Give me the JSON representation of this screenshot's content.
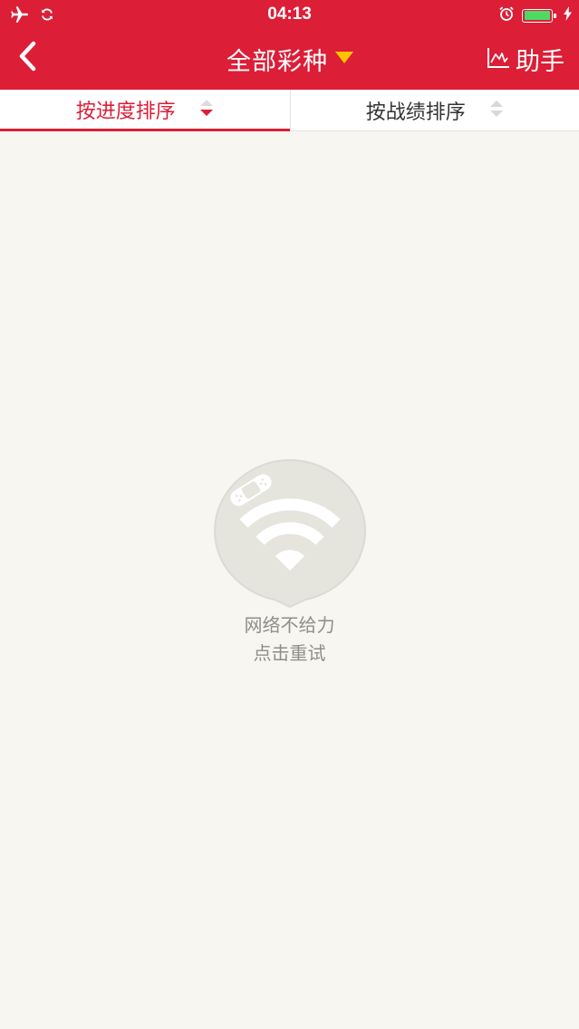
{
  "status_bar": {
    "time": "04:13",
    "battery_level": 1.0,
    "icons": [
      "airplane-icon",
      "sync-icon",
      "alarm-icon",
      "battery-icon",
      "charging-icon"
    ]
  },
  "nav": {
    "back_icon": "chevron-left-icon",
    "title": "全部彩种",
    "title_icon": "dropdown-triangle-icon",
    "helper_label": "助手",
    "helper_icon": "chart-line-icon"
  },
  "sort_tabs": [
    {
      "label": "按进度排序",
      "active": true
    },
    {
      "label": "按战绩排序",
      "active": false
    }
  ],
  "empty_state": {
    "icon": "no-network-icon",
    "line1": "网络不给力",
    "line2": "点击重试"
  },
  "colors": {
    "brand_red": "#dc1e37",
    "accent_yellow": "#ffc400",
    "background": "#f7f6f0",
    "battery_green": "#4cd964"
  }
}
